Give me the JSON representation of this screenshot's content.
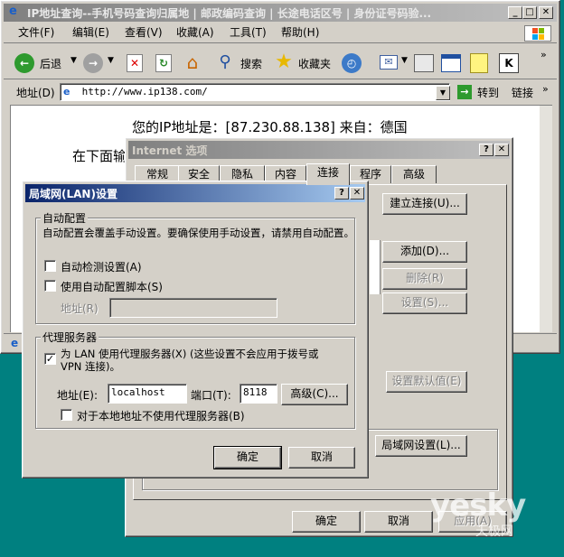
{
  "browser": {
    "title": "IP地址查询--手机号码查询归属地 | 邮政编码查询 | 长途电话区号 | 身份证号码验...",
    "menu": [
      "文件(F)",
      "编辑(E)",
      "查看(V)",
      "收藏(A)",
      "工具(T)",
      "帮助(H)"
    ],
    "toolbar": {
      "back": "后退",
      "search": "搜索",
      "favorites": "收藏夹"
    },
    "address_label": "地址(D)",
    "address_value": "http://www.ip138.com/",
    "go_label": "转到",
    "links_label": "链接",
    "page_line1": "您的IP地址是：[87.230.88.138] 来自：德国",
    "page_line2": "在下面输"
  },
  "internet_options": {
    "title": "Internet 选项",
    "tabs": [
      "常规",
      "安全",
      "隐私",
      "内容",
      "连接",
      "程序",
      "高级"
    ],
    "active_tab": "连接",
    "buttons": {
      "setup": "建立连接(U)...",
      "add": "添加(D)...",
      "remove": "删除(R)",
      "settings": "设置(S)...",
      "set_default": "设置默认值(E)",
      "lan_settings": "局域网设置(L)...",
      "ok": "确定",
      "cancel": "取消",
      "apply": "应用(A)"
    }
  },
  "lan_dialog": {
    "title": "局域网(LAN)设置",
    "auto_group": "自动配置",
    "auto_desc": "自动配置会覆盖手动设置。要确保使用手动设置，请禁用自动配置。",
    "auto_detect": "自动检测设置(A)",
    "auto_detect_checked": false,
    "use_script": "使用自动配置脚本(S)",
    "use_script_checked": false,
    "script_address_label": "地址(R)",
    "proxy_group": "代理服务器",
    "use_proxy": "为 LAN 使用代理服务器(X) (这些设置不会应用于拨号或 VPN 连接)。",
    "use_proxy_checked": true,
    "address_label": "地址(E):",
    "address_value": "localhost",
    "port_label": "端口(T):",
    "port_value": "8118",
    "advanced": "高级(C)...",
    "bypass_local": "对于本地地址不使用代理服务器(B)",
    "bypass_local_checked": false,
    "ok": "确定",
    "cancel": "取消"
  },
  "watermark": {
    "brand": "yesky",
    "sub": "天极网"
  },
  "colors": {
    "desktop": "#008080",
    "face": "#d4d0c8",
    "title_active": "#0a246a"
  }
}
